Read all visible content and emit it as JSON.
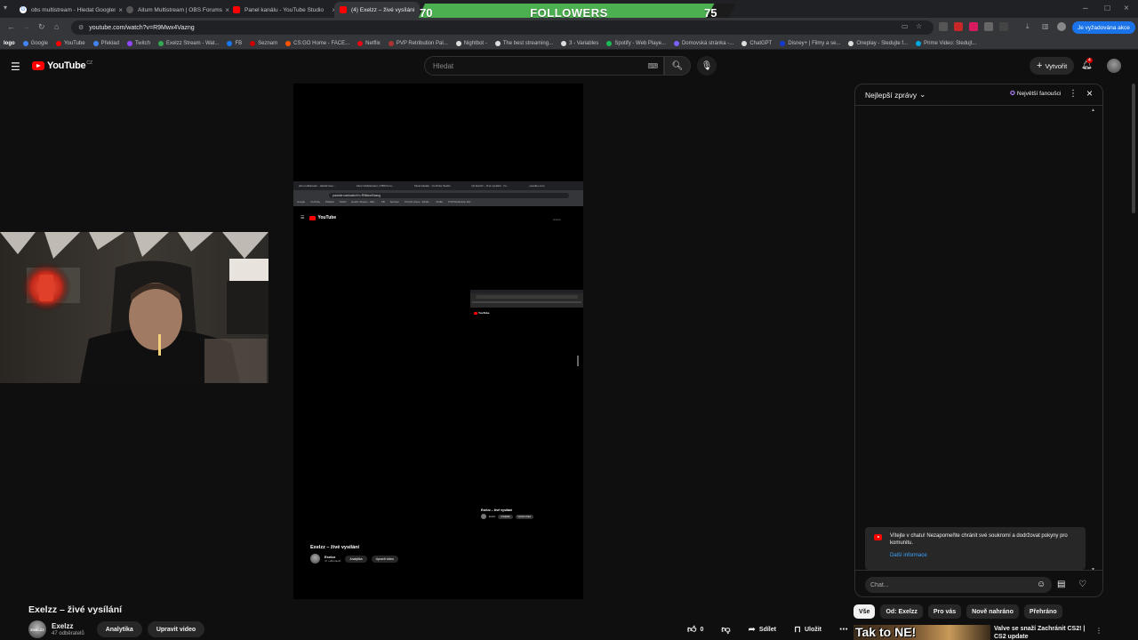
{
  "browser": {
    "tabs": [
      {
        "title": "obs multistream - Hledat Googlem",
        "active": false
      },
      {
        "title": "Aitum Multistream | OBS Forums",
        "active": false
      },
      {
        "title": "Panel kanálu - YouTube Studio",
        "active": false
      },
      {
        "title": "(4) Exelzz – živé vysílání - YouTube",
        "active": true
      }
    ],
    "url": "youtube.com/watch?v=R9Mwx4Vazng",
    "action_label": "Je vyžadována akce",
    "bookmarks": [
      {
        "label": "logo",
        "color": "#ffffff"
      },
      {
        "label": "Google",
        "color": "#4285f4"
      },
      {
        "label": "YouTube",
        "color": "#ff0000"
      },
      {
        "label": "Překlad",
        "color": "#4285f4"
      },
      {
        "label": "Twitch",
        "color": "#9146ff"
      },
      {
        "label": "Exelzz Stream - Wat...",
        "color": "#34a853"
      },
      {
        "label": "FB",
        "color": "#1877f2"
      },
      {
        "label": "Seznam",
        "color": "#cc0000"
      },
      {
        "label": "CS:GO Home - FACE...",
        "color": "#ff5500"
      },
      {
        "label": "Netflix",
        "color": "#e50914"
      },
      {
        "label": "PVP Retribution Pal...",
        "color": "#aa3333"
      },
      {
        "label": "Nightbot -",
        "color": "#dddddd"
      },
      {
        "label": "The best streaming...",
        "color": "#dddddd"
      },
      {
        "label": "3 - Variables",
        "color": "#dddddd"
      },
      {
        "label": "Spotify - Web Playe...",
        "color": "#1db954"
      },
      {
        "label": "Domovská stránka -...",
        "color": "#7b61ff"
      },
      {
        "label": "ChatGPT",
        "color": "#dddddd"
      },
      {
        "label": "Disney+ | Filmy a se...",
        "color": "#113ccf"
      },
      {
        "label": "Oneplay - Sledujte f...",
        "color": "#dddddd"
      },
      {
        "label": "Prime Video: Sledujt...",
        "color": "#00a8e1"
      }
    ]
  },
  "overlay": {
    "followers_current": "70",
    "followers_label": "FOLLOWERS",
    "followers_goal": "75",
    "progress_fraction": 0.93,
    "accent_color": "#4caf50"
  },
  "youtube": {
    "logo_text": "YouTube",
    "region": "CZ",
    "search_placeholder": "Hledat",
    "create_label": "Vytvořit",
    "notification_count": "4"
  },
  "nested_capture": {
    "tabs": [
      "obs multistream - Hledat Goo...",
      "Aitum Multistream | OBS Foru...",
      "Panel kanálu - YouTube Studio",
      "(4) Exelzz – živé vysílání - Yo...",
      "youtube.com"
    ],
    "url": "youtube.com/watch?v=R9Mwx4Vazng",
    "bookmarks": [
      "Google",
      "YouTube",
      "Překlad",
      "Twitch",
      "Exelzz Stream - Wat...",
      "FB",
      "Seznam",
      "CS:GO Home - FACE...",
      "Netflix",
      "PVP Retribution Pal..."
    ],
    "search_text": "Hledat",
    "title": "Exelzz – živé vysílání",
    "channel": "Exelzz",
    "subs": "47 odběratelů",
    "analytics": "Analytika",
    "edit": "Upravit video"
  },
  "video": {
    "title": "Exelzz – živé vysílání",
    "channel": "Exelzz",
    "avatar_text": "EXELZZ",
    "subscribers": "47 odběratelů",
    "analytics_label": "Analytika",
    "edit_label": "Upravit video",
    "likes": "0",
    "share_label": "Sdílet",
    "save_label": "Uložit"
  },
  "chat": {
    "mode_label": "Nejlepší zprávy",
    "fans_label": "Největší fanoušci",
    "welcome_text": "Vítejte v chatu! Nezapomeňte chránit své soukromí a dodržovat pokyny pro komunitu.",
    "more_info": "Další informace",
    "input_placeholder": "Chat..."
  },
  "chips": [
    "Vše",
    "Od: Exelzz",
    "Pro vás",
    "Nově nahráno",
    "Přehráno"
  ],
  "recommendation": {
    "thumb_text": "Tak to NE!",
    "title": "Valve se snaží Zachránit CS2! | CS2 update"
  }
}
